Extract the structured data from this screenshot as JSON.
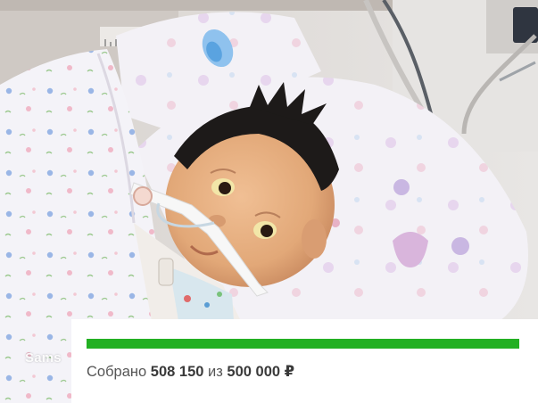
{
  "photo": {
    "description_icon": "baby-photo",
    "pillow_color": "#f1eef3",
    "blanket_color": "#f4f3f7",
    "skin_color": "#e4ae83"
  },
  "watermark": {
    "text": "Sams"
  },
  "donation": {
    "raised_label": "Собрано",
    "raised_amount": "508 150",
    "separator": "из",
    "goal_amount": "500 000 ₽",
    "progress_fraction": 1.0,
    "progress_color": "#23b023"
  }
}
